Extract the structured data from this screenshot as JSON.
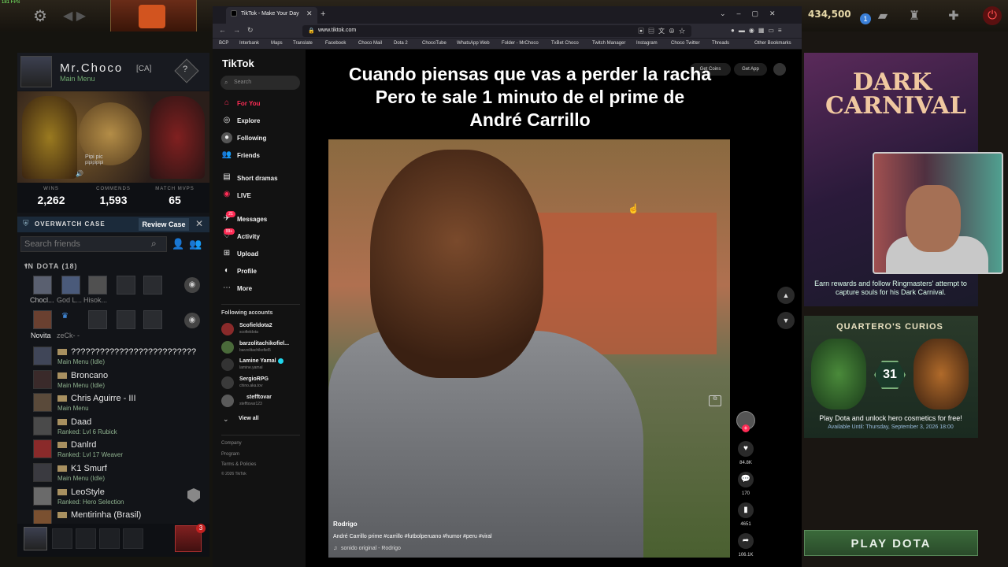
{
  "fps": "181 FPS",
  "gold": "434,500",
  "notif_count": "1",
  "profile": {
    "name": "Mr.Choco",
    "tag": "[CA]",
    "status": "Main Menu",
    "rank_symbol": "?",
    "overlay_text1": "Pipi pic",
    "overlay_text2": "pipipipipi"
  },
  "stats": {
    "wins_label": "WINS",
    "wins": "2,262",
    "commends_label": "COMMENDS",
    "commends": "1,593",
    "mvps_label": "MATCH MVPS",
    "mvps": "65"
  },
  "overwatch": {
    "label": "OVERWATCH CASE",
    "button": "Review Case",
    "close": "✕"
  },
  "friends": {
    "search_placeholder": "Search friends",
    "in_dota": "IN DOTA (18)",
    "party1": [
      "Chocl...",
      "God L...",
      "Hisok..."
    ],
    "party2": [
      "Novita",
      "zeCk-  -"
    ],
    "list": [
      {
        "name": "??????????????????????????",
        "status": "Main Menu (Idle)"
      },
      {
        "name": "Broncano",
        "status": "Main Menu (Idle)"
      },
      {
        "name": "Chris Aguirre - III",
        "status": "Main Menu"
      },
      {
        "name": "Daad",
        "status": "Ranked: Lvl 6 Rubick"
      },
      {
        "name": "Danlrd",
        "status": "Ranked: Lvl 17 Weaver"
      },
      {
        "name": "K1 Smurf",
        "status": "Main Menu (Idle)"
      },
      {
        "name": "LeoStyle",
        "status": "Ranked: Hero Selection"
      },
      {
        "name": "Mentirinha (Brasil)",
        "status": ""
      }
    ]
  },
  "bottom_badge": "3",
  "browser": {
    "tab_title": "TikTok - Make Your Day",
    "url": "www.tiktok.com",
    "bookmarks": [
      "BCP",
      "Interbank",
      "Maps",
      "Translate",
      "Choco Mail",
      "Dota 2",
      "ChocoTube",
      "WhatsApp Web",
      "Facebook",
      "Folder - MrChoco",
      "TxBet Choco",
      "Twitch Manager",
      "Instagram",
      "Choco Twitter",
      "Threads",
      "Other Bookmarks"
    ]
  },
  "tiktok": {
    "logo": "TikTok",
    "search_placeholder": "Search",
    "nav": [
      "For You",
      "Explore",
      "Following",
      "Friends",
      "Short dramas",
      "LIVE",
      "Messages",
      "Activity",
      "Upload",
      "Profile",
      "More"
    ],
    "messages_badge": "21",
    "activity_badge": "99+",
    "following_title": "Following accounts",
    "following": [
      {
        "name": "Scofieldota2",
        "handle": "scofieldota"
      },
      {
        "name": "barzolitachikofiel...",
        "handle": "barzolitachikofiel5"
      },
      {
        "name": "Lamine Yamal",
        "handle": "lamine.yamal"
      },
      {
        "name": "SergioRPG",
        "handle": "chino.aka.tov"
      },
      {
        "name": "stefftovar",
        "handle": "stefftovar123"
      }
    ],
    "view_all": "View all",
    "footer": [
      "Company",
      "Program",
      "Terms & Policies",
      "© 2026 TikTok"
    ],
    "get_coins": "Get Coins",
    "get_app": "Get App",
    "caption": "Cuando piensas que vas a perder la racha\nPero te sale 1 minuto de el prime de\nAndré Carrillo",
    "author": "Rodrigo",
    "description": "André Carrillo prime #carrillo #futbolperuano #humor #peru #viral",
    "sound": "sonido original - Rodrigo",
    "likes": "84.8K",
    "comments": "170",
    "saves": "4651",
    "shares": "106.1K"
  },
  "right": {
    "carnival_title": "DARK CARNIVAL",
    "carnival_text": "Earn rewards and follow Ringmasters' attempt to capture souls for his Dark Carnival.",
    "curios_title": "QUARTERO'S CURIOS",
    "curios_num": "31",
    "curios_text": "Play Dota and unlock hero cosmetics for free!",
    "curios_sub": "Available Until: Thursday, September 3, 2026 18:00",
    "play": "PLAY DOTA"
  }
}
